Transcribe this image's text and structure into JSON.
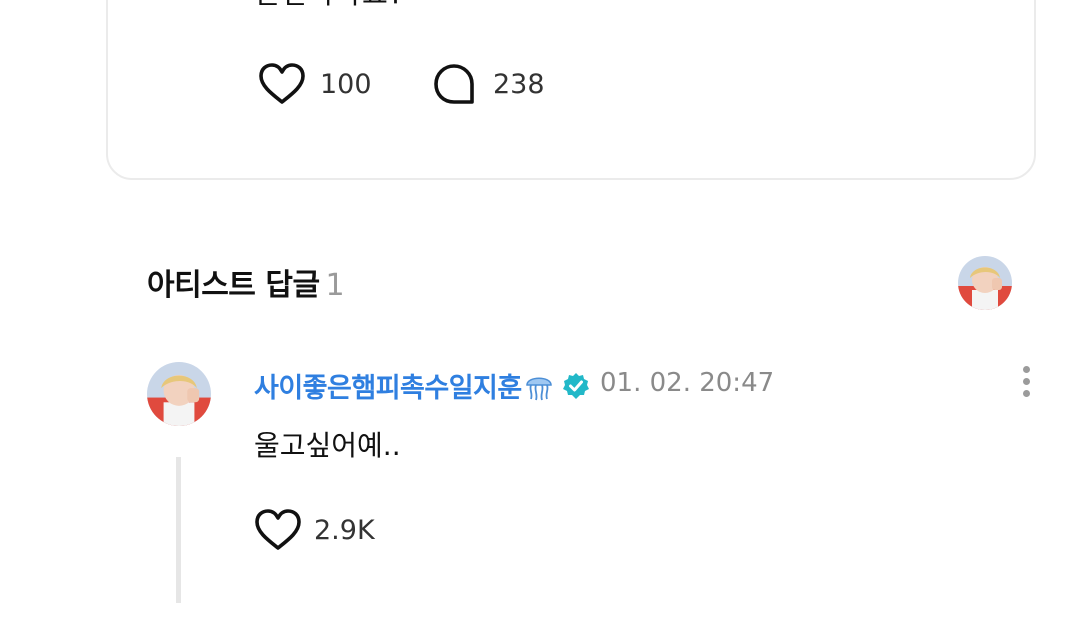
{
  "post": {
    "text": "손안아파요?",
    "likes": "100",
    "comments": "238"
  },
  "artist_replies": {
    "title": "아티스트 답글",
    "count": "1"
  },
  "reply": {
    "author": "사이좋은햄피촉수일지훈",
    "time": "01. 02. 20:47",
    "text": "울고싶어예..",
    "likes": "2.9K"
  },
  "colors": {
    "author": "#2f7fe0",
    "verified": "#22b8c8",
    "muted": "#8a8a8a",
    "divider": "#e6e6e6"
  }
}
